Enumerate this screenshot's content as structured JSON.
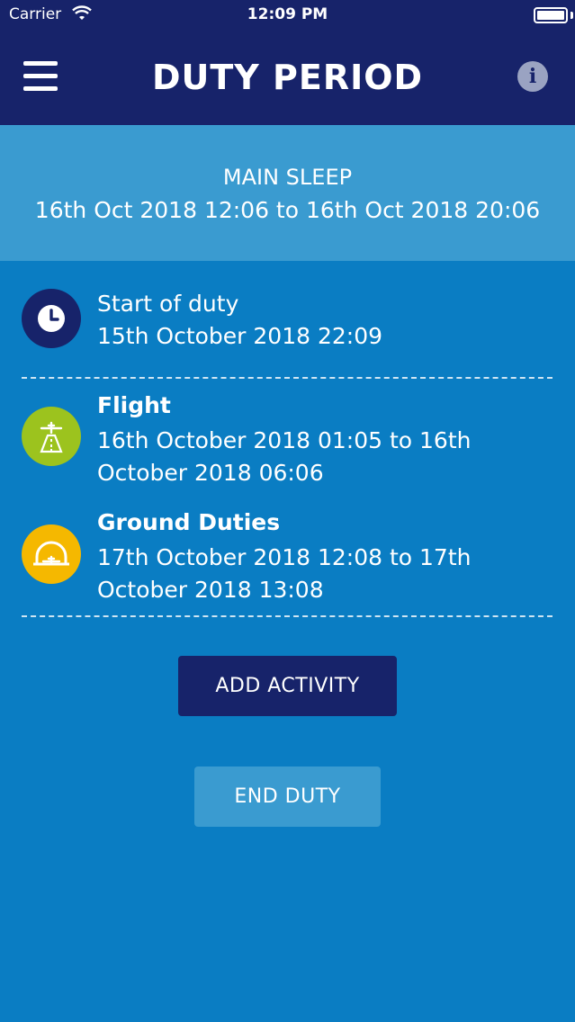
{
  "status_bar": {
    "carrier": "Carrier",
    "time": "12:09 PM"
  },
  "header": {
    "title": "DUTY PERIOD",
    "menu_icon": "hamburger-menu-icon",
    "info_icon": "info-icon",
    "info_glyph": "i"
  },
  "sleep": {
    "label": "MAIN SLEEP",
    "range": "16th Oct 2018 12:06 to 16th Oct 2018 20:06"
  },
  "activities": [
    {
      "title": "Start of duty",
      "detail": "15th October 2018 22:09",
      "icon": "clock-icon",
      "icon_color": "#17236a"
    },
    {
      "title": "Flight",
      "detail": "16th October 2018 01:05 to 16th October 2018 06:06",
      "icon": "runway-plane-icon",
      "icon_color": "#9cc31e"
    },
    {
      "title": "Ground Duties",
      "detail": "17th October 2018 12:08 to 17th October 2018 13:08",
      "icon": "hangar-icon",
      "icon_color": "#f5b800"
    }
  ],
  "buttons": {
    "add_activity": "ADD ACTIVITY",
    "end_duty": "END DUTY"
  },
  "colors": {
    "header_bg": "#17236a",
    "body_bg": "#0a7dc3",
    "band_bg": "#3a9bd0"
  }
}
